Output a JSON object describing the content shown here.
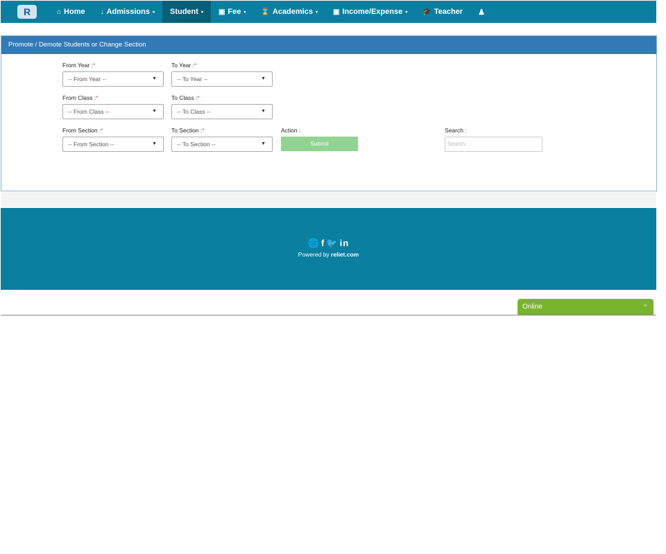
{
  "nav": {
    "logo_letter": "R",
    "items": [
      {
        "icon": "⌂",
        "label": "Home",
        "caret": ""
      },
      {
        "icon": "↓",
        "label": "Admissions",
        "caret": "▾"
      },
      {
        "icon": "",
        "label": "Student",
        "caret": "▾"
      },
      {
        "icon": "▣",
        "label": "Fee",
        "caret": "▾"
      },
      {
        "icon": "⌛",
        "label": "Academics",
        "caret": "▾"
      },
      {
        "icon": "▣",
        "label": "Income/Expense",
        "caret": "▾"
      },
      {
        "icon": "🎓",
        "label": "Teacher",
        "caret": ""
      }
    ],
    "user_icon": "♟"
  },
  "panel": {
    "title": "Promote / Demote Students or Change Section"
  },
  "form": {
    "from_year": {
      "label": "From Year :",
      "req": "*",
      "value": "-- From Year --"
    },
    "to_year": {
      "label": "To Year :",
      "req": "*",
      "value": "-- To Year --"
    },
    "from_class": {
      "label": "From Class :",
      "req": "*",
      "value": "-- From Class --"
    },
    "to_class": {
      "label": "To Class :",
      "req": "*",
      "value": "-- To Class --"
    },
    "from_section": {
      "label": "From Section :",
      "req": "*",
      "value": "-- From Section --"
    },
    "to_section": {
      "label": "To Section :",
      "req": "*",
      "value": "-- To Section --"
    },
    "action": {
      "label": "Action :",
      "button": "Submit"
    },
    "search": {
      "label": "Search :",
      "placeholder": "Search..."
    },
    "arrow": "▼"
  },
  "footer": {
    "icons": {
      "globe": "🌐",
      "facebook": "f",
      "twitter": "🐦",
      "linkedin": "in"
    },
    "powered_prefix": "Powered by ",
    "powered_link": "reliet.com"
  },
  "chat": {
    "label": "Online",
    "chevron": "^"
  },
  "colors": {
    "nav": "#0a7fa0",
    "panel_head": "#337ab7",
    "submit": "#91d391",
    "chat": "#7ab32e"
  }
}
